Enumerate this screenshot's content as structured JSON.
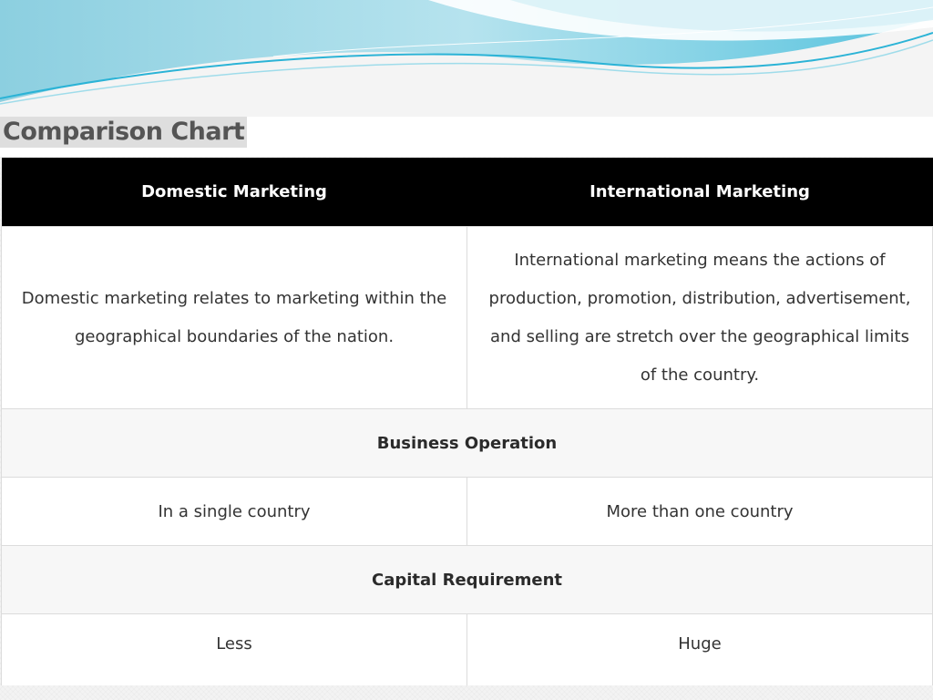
{
  "slide": {
    "title": "Comparison Chart"
  },
  "table": {
    "headers": [
      "Domestic Marketing",
      "International Marketing"
    ],
    "description": {
      "domestic": "Domestic marketing relates to marketing within the geographical boundaries of the nation.",
      "international": "International marketing means the actions of production, promotion, distribution, advertisement, and selling are stretch over the geographical limits of the country."
    },
    "sections": [
      {
        "heading": "Business Operation",
        "domestic": "In a single country",
        "international": "More than one country"
      },
      {
        "heading": "Capital Requirement",
        "domestic": "Less",
        "international": "Huge"
      }
    ]
  },
  "colors": {
    "header_bg": "#000000",
    "header_text": "#ffffff",
    "wave_light": "#bfe6f0",
    "wave_mid": "#7fd2e4",
    "wave_dark": "#1aa6c9"
  }
}
